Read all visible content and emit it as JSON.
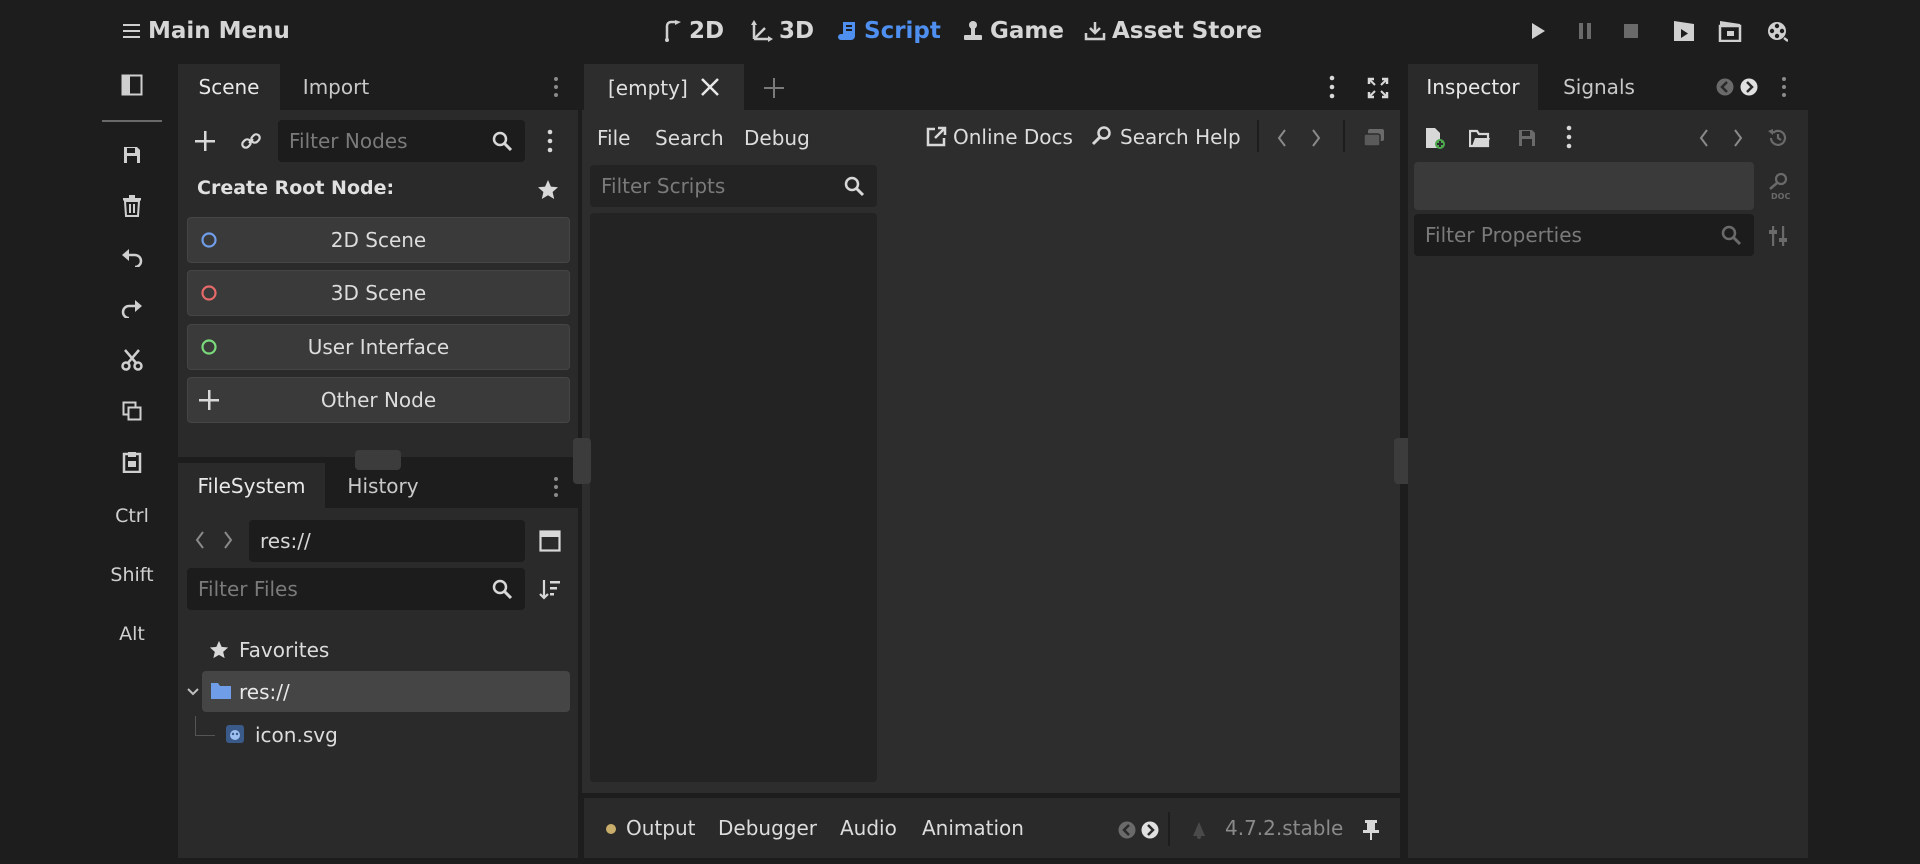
{
  "topbar": {
    "main_menu": "Main Menu",
    "workspaces": [
      {
        "label": "2D",
        "icon": "2d-workspace-icon",
        "active": false
      },
      {
        "label": "3D",
        "icon": "3d-workspace-icon",
        "active": false
      },
      {
        "label": "Script",
        "icon": "script-workspace-icon",
        "active": true
      },
      {
        "label": "Game",
        "icon": "game-workspace-icon",
        "active": false
      },
      {
        "label": "Asset Store",
        "icon": "asset-store-icon",
        "active": false
      }
    ],
    "run_controls": [
      "play-icon",
      "pause-icon",
      "stop-icon",
      "play-scene-icon",
      "play-custom-scene-icon",
      "movie-maker-icon"
    ]
  },
  "side_toolbar": {
    "icons": [
      "toggle-panel-icon",
      "save-icon",
      "delete-icon",
      "undo-icon",
      "redo-icon",
      "cut-icon",
      "copy-icon",
      "paste-icon"
    ],
    "modifiers": [
      "Ctrl",
      "Shift",
      "Alt"
    ]
  },
  "scene_dock": {
    "tabs": [
      "Scene",
      "Import"
    ],
    "filter_placeholder": "Filter Nodes",
    "create_root_label": "Create Root Node:",
    "root_buttons": [
      {
        "label": "2D Scene",
        "icon_color": "#6f9de8"
      },
      {
        "label": "3D Scene",
        "icon_color": "#e66a6a"
      },
      {
        "label": "User Interface",
        "icon_color": "#7ad97a"
      },
      {
        "label": "Other Node",
        "icon": "plus-icon"
      }
    ]
  },
  "filesystem_dock": {
    "tabs": [
      "FileSystem",
      "History"
    ],
    "path": "res://",
    "filter_placeholder": "Filter Files",
    "favorites_label": "Favorites",
    "tree": [
      {
        "label": "res://",
        "type": "folder",
        "selected": true
      },
      {
        "label": "icon.svg",
        "type": "file"
      }
    ]
  },
  "script_editor": {
    "tab_label": "[empty]",
    "menus": [
      "File",
      "Search",
      "Debug"
    ],
    "online_docs": "Online Docs",
    "search_help": "Search Help",
    "filter_placeholder": "Filter Scripts"
  },
  "bottom_panel": {
    "tabs": [
      "Output",
      "Debugger",
      "Audio",
      "Animation"
    ],
    "version": "4.7.2.stable",
    "output_dot_color": "#c9ad6a"
  },
  "inspector": {
    "tabs": [
      "Inspector",
      "Signals"
    ],
    "filter_placeholder": "Filter Properties"
  },
  "colors": {
    "accent": "#4e8ff0",
    "background": "#1d1d1d",
    "panel": "#2a2a2a"
  }
}
